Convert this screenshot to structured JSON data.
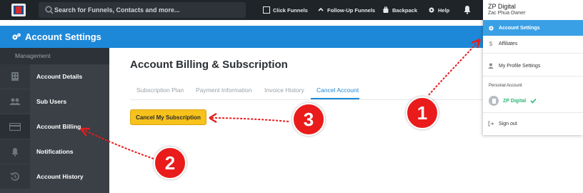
{
  "topbar": {
    "search_placeholder": "Search for Funnels, Contacts and more...",
    "links": {
      "click_funnels": "Click Funnels",
      "followup_funnels": "Follow-Up Funnels",
      "backpack": "Backpack",
      "help": "Help"
    }
  },
  "header": {
    "title": "Account Settings"
  },
  "sidebar": {
    "section": "Management",
    "items": [
      {
        "label": "Account Details",
        "icon": "building-icon"
      },
      {
        "label": "Sub Users",
        "icon": "users-icon"
      },
      {
        "label": "Account Billing",
        "icon": "card-icon"
      },
      {
        "label": "Notifications",
        "icon": "bell-icon"
      },
      {
        "label": "Account History",
        "icon": "history-icon"
      }
    ]
  },
  "main": {
    "title": "Account Billing & Subscription",
    "tabs": [
      {
        "label": "Subscription Plan"
      },
      {
        "label": "Payment Information"
      },
      {
        "label": "Invoice History"
      },
      {
        "label": "Cancel Account"
      }
    ],
    "cancel_button": "Cancel My Subscription"
  },
  "dropdown": {
    "name": "ZP Digital",
    "subtitle": "Zac Phua   Owner",
    "items": {
      "account_settings": "Account Settings",
      "affiliates": "Affiliates",
      "my_profile": "My Profile Settings",
      "sign_out": "Sign out"
    },
    "section_label": "Personal Account",
    "account_name": "ZP Digital"
  },
  "annotations": [
    "1",
    "2",
    "3"
  ],
  "colors": {
    "topbar": "#1f2428",
    "header": "#1e88d8",
    "sidebar": "#3a4046",
    "button": "#f7c21c",
    "active_tab": "#1e88d8",
    "annotation": "#ea1b1b"
  }
}
